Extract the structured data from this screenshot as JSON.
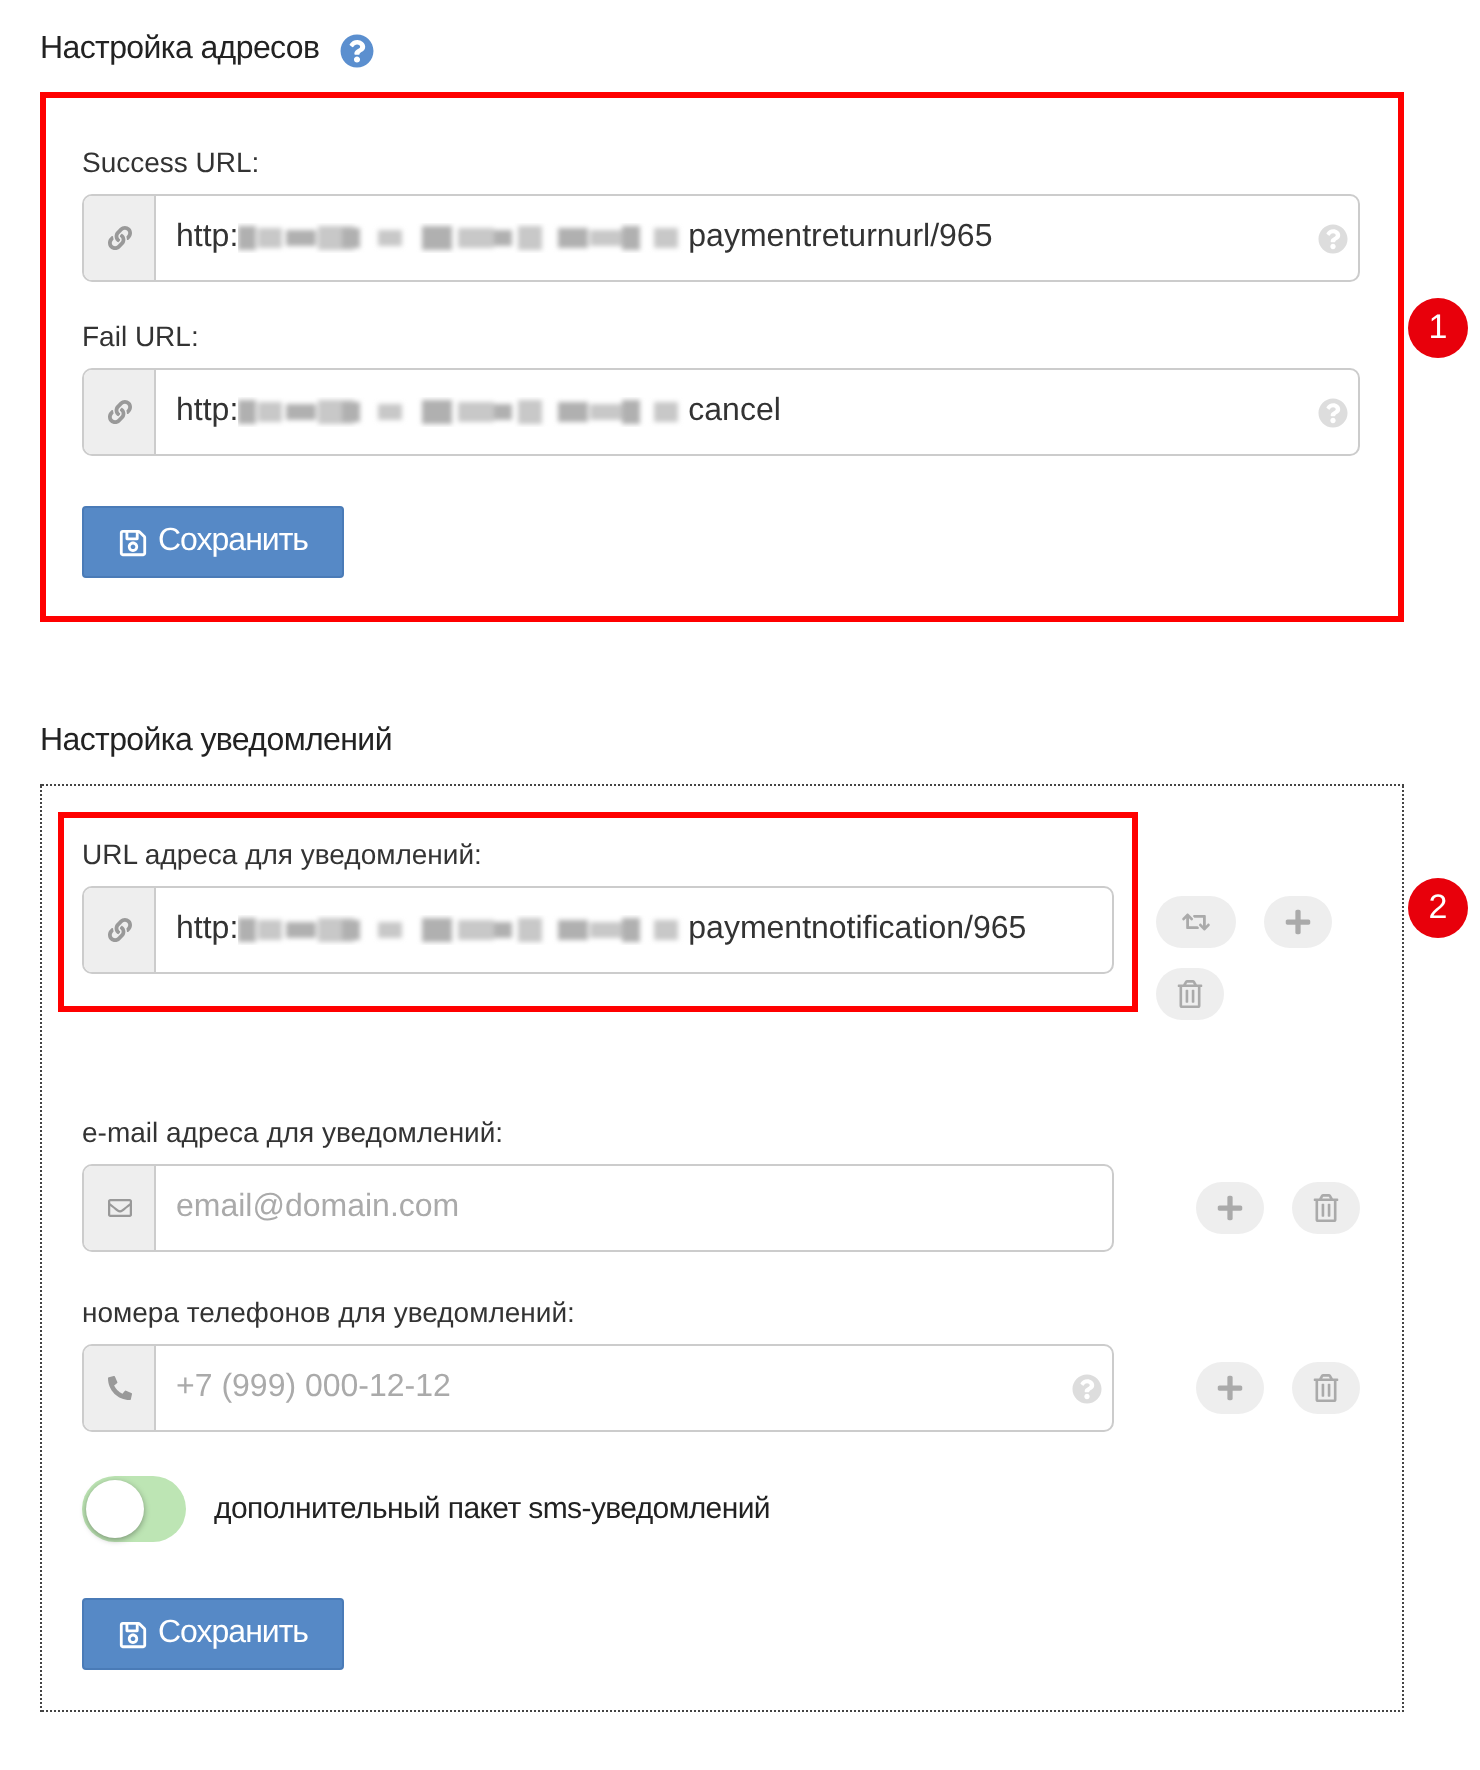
{
  "address_settings": {
    "title": "Настройка адресов",
    "help": true,
    "annotation": "1",
    "fields": [
      {
        "label": "Success URL:",
        "kind": "link",
        "value_start": "http:",
        "redacted": true,
        "value_end": "paymentreturnurl/965",
        "help": true
      },
      {
        "label": "Fail URL:",
        "kind": "link",
        "value_start": "http:",
        "redacted": true,
        "value_end": "cancel",
        "help": true
      }
    ],
    "save_button": "Сохранить"
  },
  "notification_settings": {
    "title": "Настройка уведомлений",
    "fields": [
      {
        "label": "URL адреса для уведомлений:",
        "kind": "link",
        "value_start": "http:",
        "redacted": true,
        "value_end": "paymentnotification/965",
        "help": false,
        "annotation": "2",
        "actions": [
          {
            "kind": "swap"
          },
          {
            "kind": "add"
          },
          {
            "kind": "delete"
          }
        ]
      },
      {
        "label": "e-mail адреса для уведомлений:",
        "kind": "mail",
        "placeholder": "email@domain.com",
        "help": false,
        "actions": [
          {
            "kind": "add"
          },
          {
            "kind": "delete"
          }
        ]
      },
      {
        "label": "номера телефонов для уведомлений:",
        "kind": "phone",
        "placeholder": "+7 (999) 000-12-12",
        "help": true,
        "actions": [
          {
            "kind": "add"
          },
          {
            "kind": "delete"
          }
        ]
      }
    ],
    "sms_package": {
      "label": "дополнительный пакет sms-уведомлений",
      "on": false
    },
    "save_button": "Сохранить"
  }
}
